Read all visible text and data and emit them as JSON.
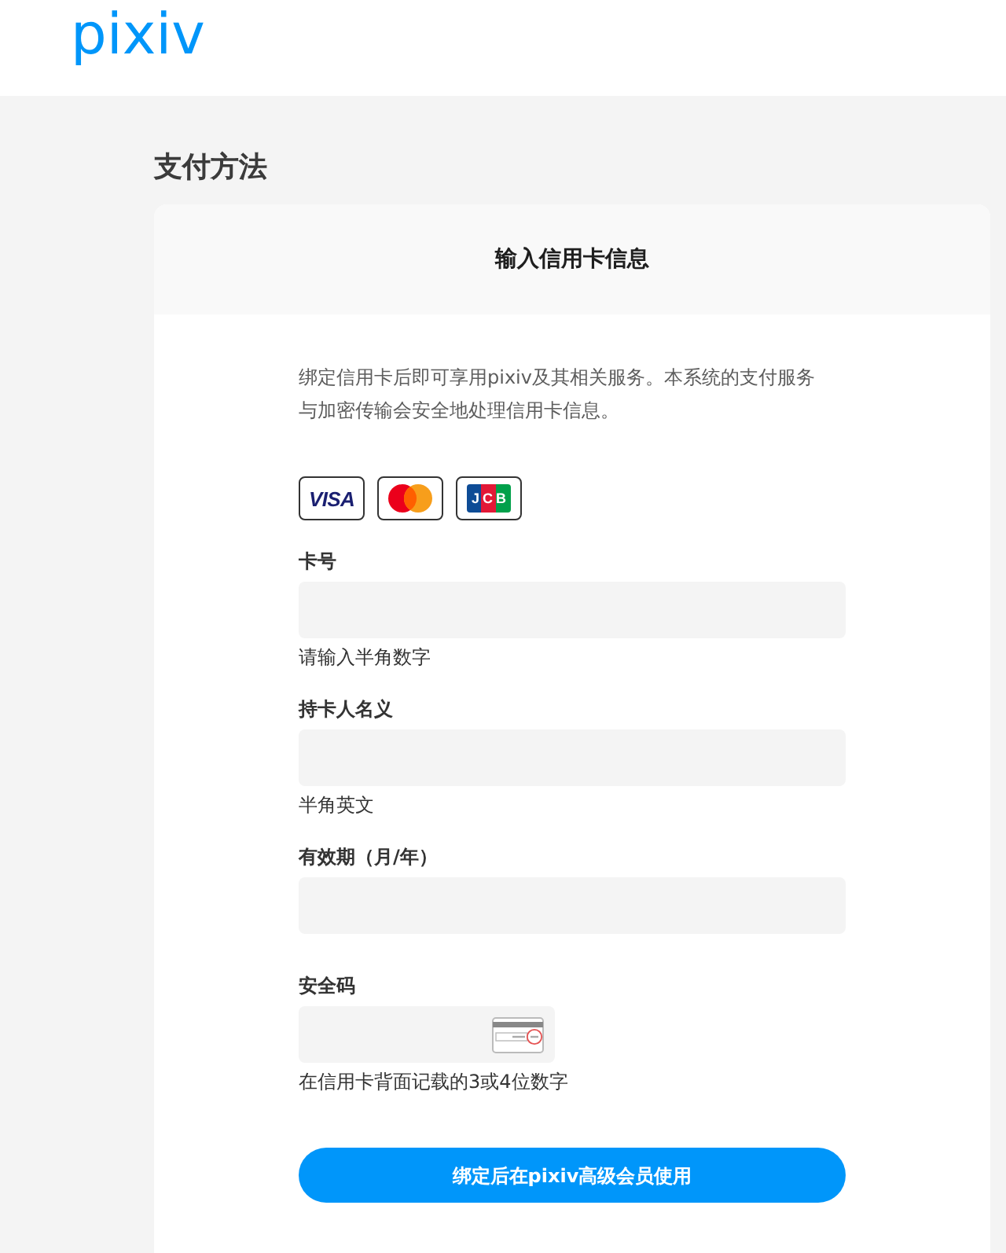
{
  "header": {
    "logo": "pixiv"
  },
  "page_title": "支付方法",
  "card": {
    "title": "输入信用卡信息",
    "description": "绑定信用卡后即可享用pixiv及其相关服务。本系统的支付服务与加密传输会安全地处理信用卡信息。",
    "card_brands": [
      {
        "kind": "visa",
        "label": "VISA"
      },
      {
        "kind": "mastercard"
      },
      {
        "kind": "jcb",
        "label": "JCB"
      }
    ],
    "fields": [
      {
        "kind": "text",
        "label": "卡号",
        "hint": "请输入半角数字"
      },
      {
        "kind": "text",
        "label": "持卡人名义",
        "hint": "半角英文"
      },
      {
        "kind": "text",
        "label": "有效期（月/年）"
      },
      {
        "kind": "security_code",
        "label": "安全码",
        "hint": "在信用卡背面记载的3或4位数字"
      }
    ],
    "submit_button": "绑定后在pixiv高级会员使用"
  }
}
